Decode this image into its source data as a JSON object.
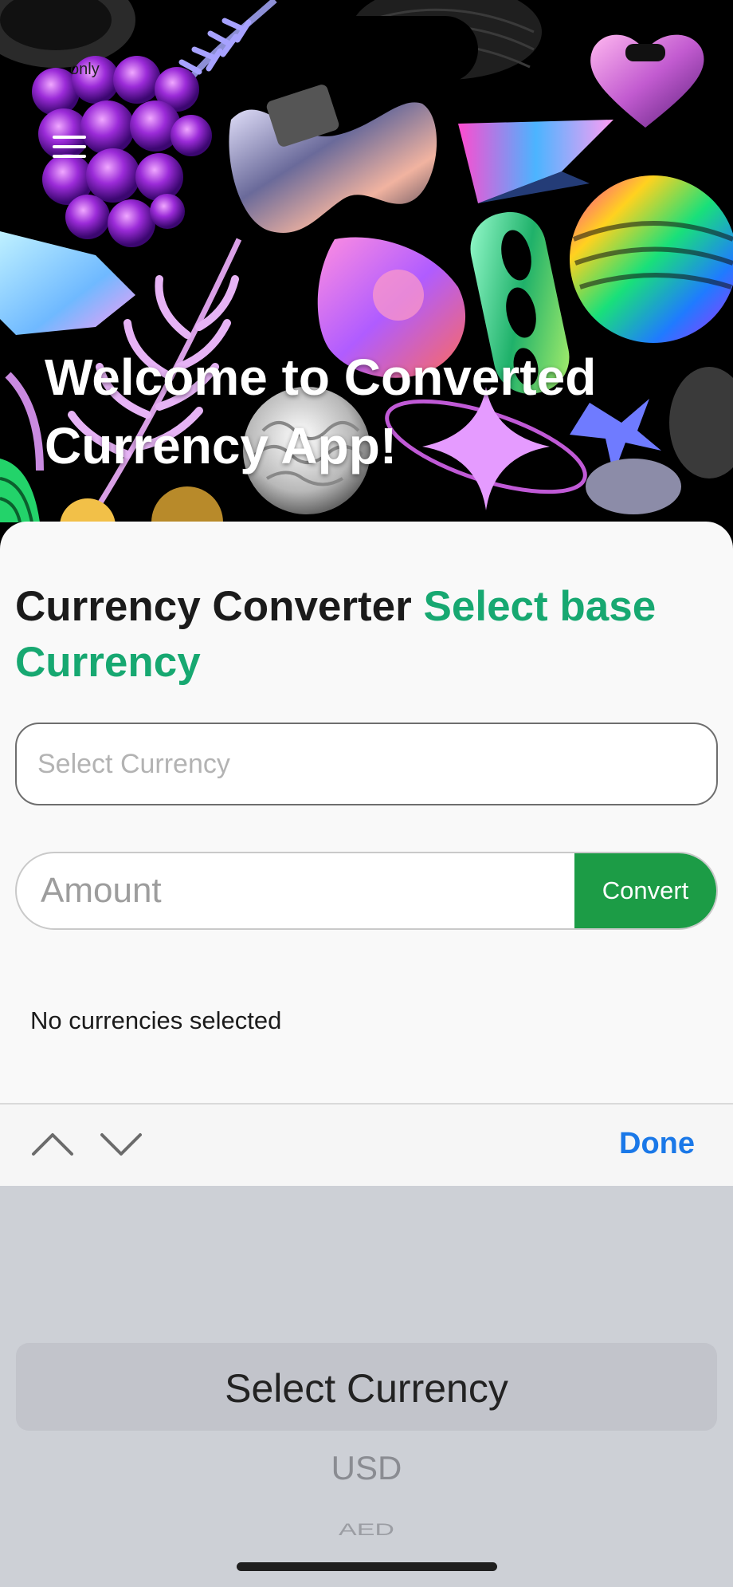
{
  "status_bar": {
    "text": "only"
  },
  "hero": {
    "menu_icon": "hamburger-menu-icon",
    "title": "Welcome to Converted Currency App!"
  },
  "converter": {
    "heading": "Currency Converter",
    "heading_accent": "Select base Currency",
    "accent_color": "#17a871",
    "currency_select": {
      "placeholder": "Select Currency"
    },
    "amount": {
      "placeholder": "Amount",
      "value": ""
    },
    "convert_label": "Convert",
    "convert_color": "#1c9c46",
    "empty_state": "No currencies selected"
  },
  "toolbar": {
    "prev_icon": "chevron-up-icon",
    "next_icon": "chevron-down-icon",
    "done_label": "Done",
    "done_color": "#1a78e8"
  },
  "picker": {
    "selected": "Select Currency",
    "options": [
      "USD",
      "AED"
    ]
  }
}
